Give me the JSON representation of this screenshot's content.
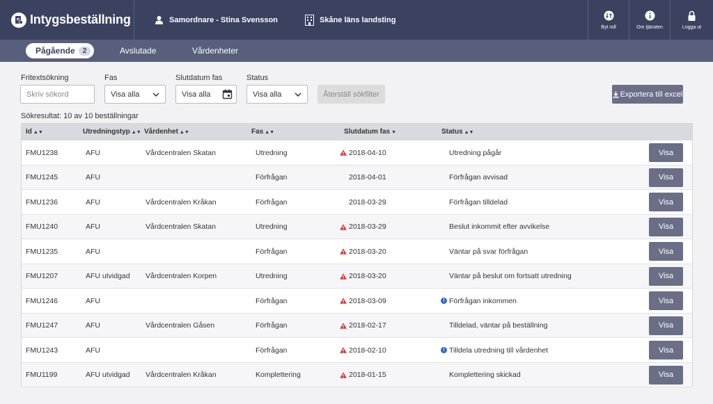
{
  "app": {
    "title": "Intygsbeställning"
  },
  "header": {
    "user": "Samordnare - Stina Svensson",
    "unit": "Skåne läns landsting",
    "tools": [
      {
        "label": "Byt roll",
        "icon": "swap-role-icon"
      },
      {
        "label": "Om tjänsten",
        "icon": "info-icon"
      },
      {
        "label": "Logga ut",
        "icon": "lock-icon"
      }
    ]
  },
  "nav": {
    "tabs": [
      {
        "label": "Pågående",
        "badge": "2"
      },
      {
        "label": "Avslutade"
      },
      {
        "label": "Vårdenheter"
      }
    ]
  },
  "filters": {
    "search_label": "Fritextsökning",
    "search_placeholder": "Skriv sökord",
    "fas_label": "Fas",
    "fas_value": "Visa alla",
    "slutdatum_label": "Slutdatum fas",
    "slutdatum_value": "Visa alla",
    "status_label": "Status",
    "status_value": "Visa alla",
    "reset_label": "Återställ sökfilter",
    "export_label": "Exportera till excel"
  },
  "result_text": "Sökresultat: 10 av 10 beställningar",
  "table": {
    "headers": [
      "Id",
      "Utredningstyp",
      "Vårdenhet",
      "Fas",
      "Slutdatum fas",
      "Status"
    ],
    "button_label": "Visa",
    "rows": [
      {
        "id": "FMU1238",
        "typ": "AFU",
        "enhet": "Vårdcentralen Skatan",
        "fas": "Utredning",
        "datum": "2018-04-10",
        "warn": true,
        "status": "Utredning pågår",
        "info": false
      },
      {
        "id": "FMU1245",
        "typ": "AFU",
        "enhet": "",
        "fas": "Förfrågan",
        "datum": "2018-04-01",
        "warn": false,
        "status": "Förfrågan avvisad",
        "info": false
      },
      {
        "id": "FMU1236",
        "typ": "AFU",
        "enhet": "Vårdcentralen Kråkan",
        "fas": "Förfrågan",
        "datum": "2018-03-29",
        "warn": false,
        "status": "Förfrågan tilldelad",
        "info": false
      },
      {
        "id": "FMU1240",
        "typ": "AFU",
        "enhet": "Vårdcentralen Skatan",
        "fas": "Utredning",
        "datum": "2018-03-29",
        "warn": true,
        "status": "Beslut inkommit efter avvikelse",
        "info": false
      },
      {
        "id": "FMU1235",
        "typ": "AFU",
        "enhet": "",
        "fas": "Förfrågan",
        "datum": "2018-03-20",
        "warn": true,
        "status": "Väntar på svar förfrågan",
        "info": false
      },
      {
        "id": "FMU1207",
        "typ": "AFU utvidgad",
        "enhet": "Vårdcentralen Korpen",
        "fas": "Utredning",
        "datum": "2018-03-20",
        "warn": true,
        "status": "Väntar på beslut om fortsatt utredning",
        "info": false
      },
      {
        "id": "FMU1246",
        "typ": "AFU",
        "enhet": "",
        "fas": "Förfrågan",
        "datum": "2018-03-09",
        "warn": true,
        "status": "Förfrågan inkommen",
        "info": true
      },
      {
        "id": "FMU1247",
        "typ": "AFU",
        "enhet": "Vårdcentralen Gåsen",
        "fas": "Förfrågan",
        "datum": "2018-02-17",
        "warn": true,
        "status": "Tilldelad, väntar på beställning",
        "info": false
      },
      {
        "id": "FMU1243",
        "typ": "AFU",
        "enhet": "",
        "fas": "Förfrågan",
        "datum": "2018-02-10",
        "warn": true,
        "status": "Tilldela utredning till vårdenhet",
        "info": true
      },
      {
        "id": "FMU1199",
        "typ": "AFU utvidgad",
        "enhet": "Vårdcentralen Kråkan",
        "fas": "Komplettering",
        "datum": "2018-01-15",
        "warn": true,
        "status": "Komplettering skickad",
        "info": false
      }
    ]
  },
  "colors": {
    "header": "#3b4260",
    "nav": "#575f7c",
    "button": "#6a6e86",
    "warning": "#d9323a",
    "info": "#3366cc"
  }
}
